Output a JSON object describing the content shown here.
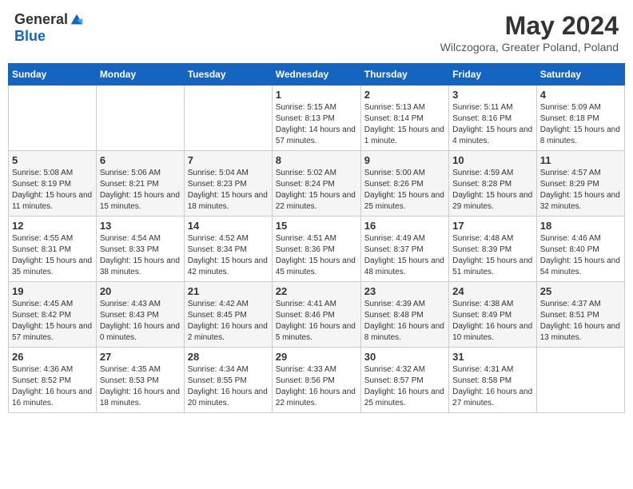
{
  "header": {
    "logo": {
      "general": "General",
      "blue": "Blue"
    },
    "title": "May 2024",
    "location": "Wilczogora, Greater Poland, Poland"
  },
  "calendar": {
    "days_of_week": [
      "Sunday",
      "Monday",
      "Tuesday",
      "Wednesday",
      "Thursday",
      "Friday",
      "Saturday"
    ],
    "weeks": [
      [
        {
          "day": "",
          "info": ""
        },
        {
          "day": "",
          "info": ""
        },
        {
          "day": "",
          "info": ""
        },
        {
          "day": "1",
          "sunrise": "Sunrise: 5:15 AM",
          "sunset": "Sunset: 8:13 PM",
          "daylight": "Daylight: 14 hours and 57 minutes."
        },
        {
          "day": "2",
          "sunrise": "Sunrise: 5:13 AM",
          "sunset": "Sunset: 8:14 PM",
          "daylight": "Daylight: 15 hours and 1 minute."
        },
        {
          "day": "3",
          "sunrise": "Sunrise: 5:11 AM",
          "sunset": "Sunset: 8:16 PM",
          "daylight": "Daylight: 15 hours and 4 minutes."
        },
        {
          "day": "4",
          "sunrise": "Sunrise: 5:09 AM",
          "sunset": "Sunset: 8:18 PM",
          "daylight": "Daylight: 15 hours and 8 minutes."
        }
      ],
      [
        {
          "day": "5",
          "sunrise": "Sunrise: 5:08 AM",
          "sunset": "Sunset: 8:19 PM",
          "daylight": "Daylight: 15 hours and 11 minutes."
        },
        {
          "day": "6",
          "sunrise": "Sunrise: 5:06 AM",
          "sunset": "Sunset: 8:21 PM",
          "daylight": "Daylight: 15 hours and 15 minutes."
        },
        {
          "day": "7",
          "sunrise": "Sunrise: 5:04 AM",
          "sunset": "Sunset: 8:23 PM",
          "daylight": "Daylight: 15 hours and 18 minutes."
        },
        {
          "day": "8",
          "sunrise": "Sunrise: 5:02 AM",
          "sunset": "Sunset: 8:24 PM",
          "daylight": "Daylight: 15 hours and 22 minutes."
        },
        {
          "day": "9",
          "sunrise": "Sunrise: 5:00 AM",
          "sunset": "Sunset: 8:26 PM",
          "daylight": "Daylight: 15 hours and 25 minutes."
        },
        {
          "day": "10",
          "sunrise": "Sunrise: 4:59 AM",
          "sunset": "Sunset: 8:28 PM",
          "daylight": "Daylight: 15 hours and 29 minutes."
        },
        {
          "day": "11",
          "sunrise": "Sunrise: 4:57 AM",
          "sunset": "Sunset: 8:29 PM",
          "daylight": "Daylight: 15 hours and 32 minutes."
        }
      ],
      [
        {
          "day": "12",
          "sunrise": "Sunrise: 4:55 AM",
          "sunset": "Sunset: 8:31 PM",
          "daylight": "Daylight: 15 hours and 35 minutes."
        },
        {
          "day": "13",
          "sunrise": "Sunrise: 4:54 AM",
          "sunset": "Sunset: 8:33 PM",
          "daylight": "Daylight: 15 hours and 38 minutes."
        },
        {
          "day": "14",
          "sunrise": "Sunrise: 4:52 AM",
          "sunset": "Sunset: 8:34 PM",
          "daylight": "Daylight: 15 hours and 42 minutes."
        },
        {
          "day": "15",
          "sunrise": "Sunrise: 4:51 AM",
          "sunset": "Sunset: 8:36 PM",
          "daylight": "Daylight: 15 hours and 45 minutes."
        },
        {
          "day": "16",
          "sunrise": "Sunrise: 4:49 AM",
          "sunset": "Sunset: 8:37 PM",
          "daylight": "Daylight: 15 hours and 48 minutes."
        },
        {
          "day": "17",
          "sunrise": "Sunrise: 4:48 AM",
          "sunset": "Sunset: 8:39 PM",
          "daylight": "Daylight: 15 hours and 51 minutes."
        },
        {
          "day": "18",
          "sunrise": "Sunrise: 4:46 AM",
          "sunset": "Sunset: 8:40 PM",
          "daylight": "Daylight: 15 hours and 54 minutes."
        }
      ],
      [
        {
          "day": "19",
          "sunrise": "Sunrise: 4:45 AM",
          "sunset": "Sunset: 8:42 PM",
          "daylight": "Daylight: 15 hours and 57 minutes."
        },
        {
          "day": "20",
          "sunrise": "Sunrise: 4:43 AM",
          "sunset": "Sunset: 8:43 PM",
          "daylight": "Daylight: 16 hours and 0 minutes."
        },
        {
          "day": "21",
          "sunrise": "Sunrise: 4:42 AM",
          "sunset": "Sunset: 8:45 PM",
          "daylight": "Daylight: 16 hours and 2 minutes."
        },
        {
          "day": "22",
          "sunrise": "Sunrise: 4:41 AM",
          "sunset": "Sunset: 8:46 PM",
          "daylight": "Daylight: 16 hours and 5 minutes."
        },
        {
          "day": "23",
          "sunrise": "Sunrise: 4:39 AM",
          "sunset": "Sunset: 8:48 PM",
          "daylight": "Daylight: 16 hours and 8 minutes."
        },
        {
          "day": "24",
          "sunrise": "Sunrise: 4:38 AM",
          "sunset": "Sunset: 8:49 PM",
          "daylight": "Daylight: 16 hours and 10 minutes."
        },
        {
          "day": "25",
          "sunrise": "Sunrise: 4:37 AM",
          "sunset": "Sunset: 8:51 PM",
          "daylight": "Daylight: 16 hours and 13 minutes."
        }
      ],
      [
        {
          "day": "26",
          "sunrise": "Sunrise: 4:36 AM",
          "sunset": "Sunset: 8:52 PM",
          "daylight": "Daylight: 16 hours and 16 minutes."
        },
        {
          "day": "27",
          "sunrise": "Sunrise: 4:35 AM",
          "sunset": "Sunset: 8:53 PM",
          "daylight": "Daylight: 16 hours and 18 minutes."
        },
        {
          "day": "28",
          "sunrise": "Sunrise: 4:34 AM",
          "sunset": "Sunset: 8:55 PM",
          "daylight": "Daylight: 16 hours and 20 minutes."
        },
        {
          "day": "29",
          "sunrise": "Sunrise: 4:33 AM",
          "sunset": "Sunset: 8:56 PM",
          "daylight": "Daylight: 16 hours and 22 minutes."
        },
        {
          "day": "30",
          "sunrise": "Sunrise: 4:32 AM",
          "sunset": "Sunset: 8:57 PM",
          "daylight": "Daylight: 16 hours and 25 minutes."
        },
        {
          "day": "31",
          "sunrise": "Sunrise: 4:31 AM",
          "sunset": "Sunset: 8:58 PM",
          "daylight": "Daylight: 16 hours and 27 minutes."
        },
        {
          "day": "",
          "info": ""
        }
      ]
    ]
  }
}
